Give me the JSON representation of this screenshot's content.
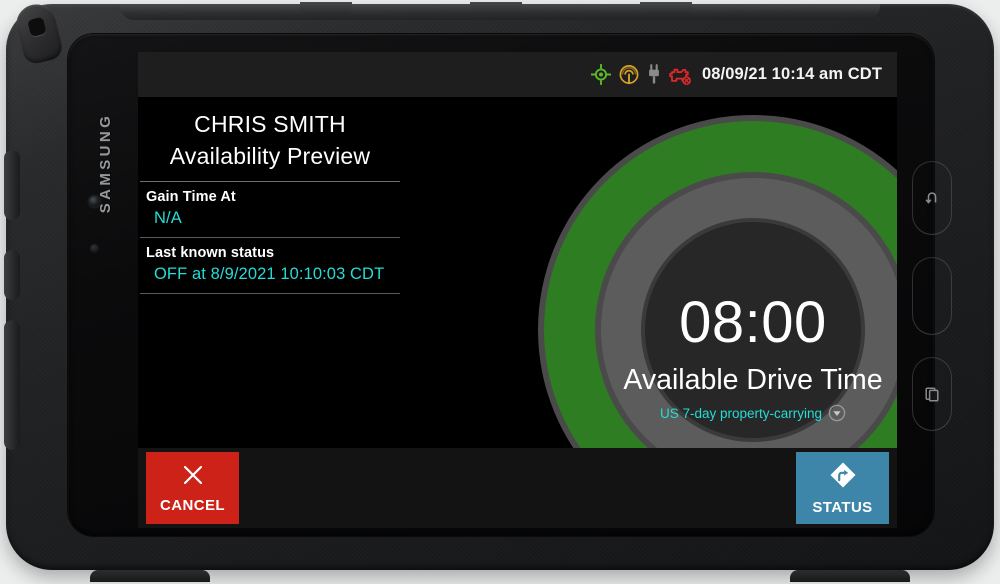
{
  "device": {
    "brand": "SAMSUNG",
    "nav_keys": [
      {
        "name": "back",
        "label": "Back"
      },
      {
        "name": "home",
        "label": "Home"
      },
      {
        "name": "recents",
        "label": "Recent apps"
      }
    ]
  },
  "statusbar": {
    "clock": "08/09/21 10:14 am CDT",
    "icons": [
      {
        "name": "gps-icon",
        "color": "#5db82a"
      },
      {
        "name": "signal-icon",
        "color": "#d8a326"
      },
      {
        "name": "power-plug-icon",
        "color": "#8a8a8a"
      },
      {
        "name": "engine-fault-icon",
        "color": "#e02828"
      }
    ]
  },
  "left_panel": {
    "driver_name": "CHRIS SMITH",
    "title": "Availability Preview",
    "fields": [
      {
        "label": "Gain Time At",
        "value": "N/A"
      },
      {
        "label": "Last known status",
        "value": "OFF at  8/9/2021 10:10:03 CDT"
      }
    ]
  },
  "gauge": {
    "time": "08:00",
    "caption": "Available Drive Time",
    "ruleset": "US 7-day property-carrying",
    "dropdown_icon": "chevron-down-circle-icon",
    "colors": {
      "arc_remaining": "#2f7d22",
      "arc_track": "#5c5c5c",
      "hub": "#272727"
    }
  },
  "bottom_bar": {
    "buttons": [
      {
        "name": "cancel",
        "label": "CANCEL",
        "icon": "close-x-icon",
        "color": "#cc2217"
      },
      {
        "name": "status",
        "label": "STATUS",
        "icon": "turn-right-diamond-icon",
        "color": "#3d86a9"
      }
    ]
  },
  "theme": {
    "accent_cyan": "#25dcd6",
    "screen_background": "#000000",
    "statusbar_background": "#1e1e1e",
    "bottombar_background": "#131313"
  }
}
